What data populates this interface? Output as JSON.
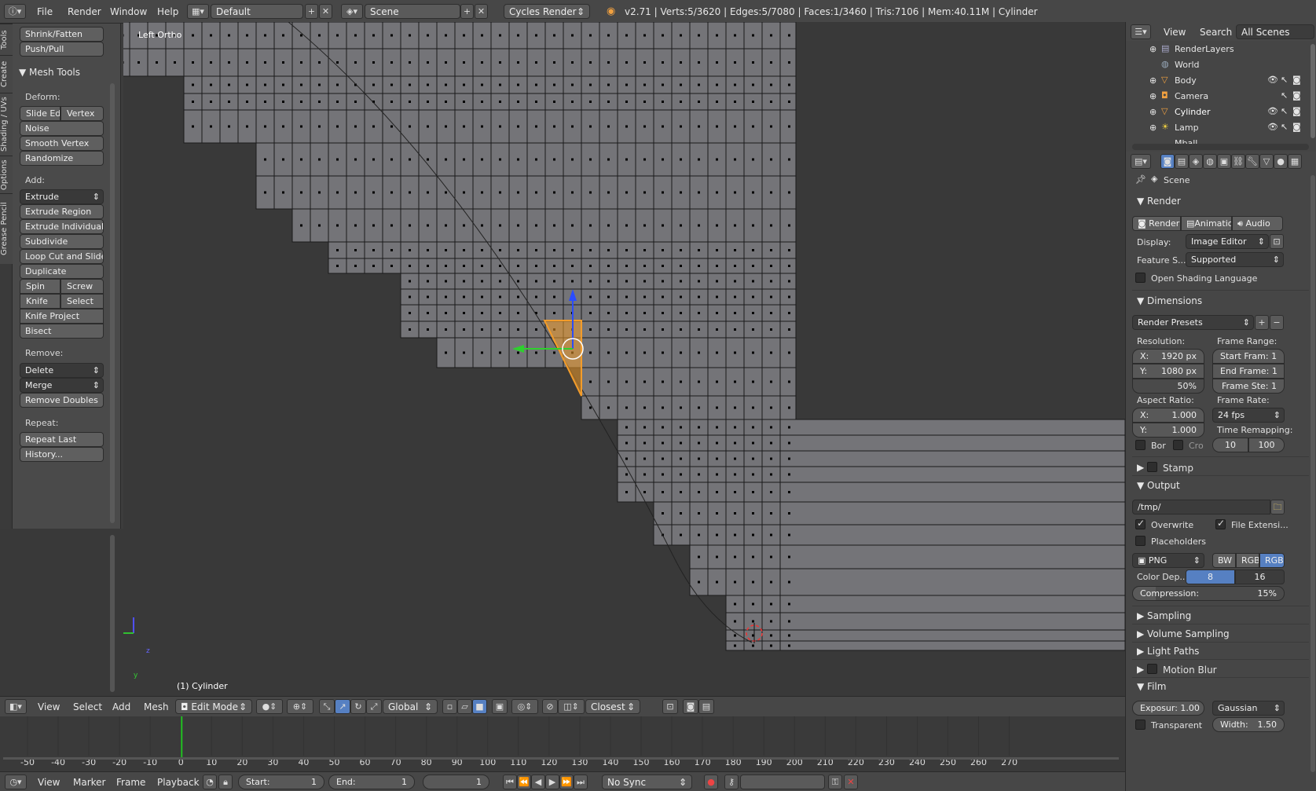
{
  "topbar": {
    "menus": [
      "File",
      "Render",
      "Window",
      "Help"
    ],
    "layout": "Default",
    "scene": "Scene",
    "engine": "Cycles Render",
    "stats": "v2.71 | Verts:5/3620 | Edges:5/7080 | Faces:1/3460 | Tris:7106 | Mem:40.11M | Cylinder"
  },
  "vtabs": [
    "Tools",
    "Create",
    "Shading / UVs",
    "Options",
    "Grease Pencil"
  ],
  "tools": {
    "top_buttons": [
      "Shrink/Fatten",
      "Push/Pull"
    ],
    "section": "Mesh Tools",
    "deform_label": "Deform:",
    "slide_edge": "Slide Ed",
    "vertex": "Vertex",
    "deform_buttons": [
      "Noise",
      "Smooth Vertex",
      "Randomize"
    ],
    "add_label": "Add:",
    "extrude": "Extrude",
    "add_buttons": [
      "Extrude Region",
      "Extrude Individual",
      "Subdivide",
      "Loop Cut and Slide",
      "Duplicate"
    ],
    "spin": "Spin",
    "screw": "Screw",
    "knife": "Knife",
    "select": "Select",
    "knife_project": "Knife Project",
    "bisect": "Bisect",
    "remove_label": "Remove:",
    "delete": "Delete",
    "merge": "Merge",
    "remove_doubles": "Remove Doubles",
    "repeat_label": "Repeat:",
    "repeat_last": "Repeat Last",
    "history": "History..."
  },
  "viewport": {
    "view_name": "Left Ortho",
    "object_label": "(1) Cylinder",
    "axis_x": "y",
    "axis_y": "z"
  },
  "vp_header": {
    "menus": [
      "View",
      "Select",
      "Add",
      "Mesh"
    ],
    "mode": "Edit Mode",
    "orientation": "Global",
    "snap": "Closest"
  },
  "timeline": {
    "ticks": [
      "-50",
      "-40",
      "-30",
      "-20",
      "-10",
      "0",
      "10",
      "20",
      "30",
      "40",
      "50",
      "60",
      "70",
      "80",
      "90",
      "100",
      "110",
      "120",
      "130",
      "140",
      "150",
      "160",
      "170",
      "180",
      "190",
      "200",
      "210",
      "220",
      "230",
      "240",
      "250",
      "260",
      "270"
    ],
    "current_frame_marker": 0,
    "footer_menus": [
      "View",
      "Marker",
      "Frame",
      "Playback"
    ],
    "start_label": "Start:",
    "start_value": "1",
    "end_label": "End:",
    "end_value": "1",
    "current": "1",
    "sync": "No Sync"
  },
  "outliner": {
    "view": "View",
    "search": "Search",
    "filter": "All Scenes",
    "rows": [
      "RenderLayers",
      "World",
      "Body",
      "Camera",
      "Cylinder",
      "Lamp",
      "Mball"
    ]
  },
  "props": {
    "context": "Scene",
    "render_section": "Render",
    "render_btn": "Render",
    "anim_btn": "Animatio",
    "audio_btn": "Audio",
    "display_label": "Display:",
    "display_value": "Image Editor",
    "feature_label": "Feature S...",
    "feature_value": "Supported",
    "osl": "Open Shading Language",
    "dimensions": "Dimensions",
    "render_presets": "Render Presets",
    "resolution": "Resolution:",
    "res_x": "X:",
    "res_x_val": "1920 px",
    "res_y": "Y:",
    "res_y_val": "1080 px",
    "res_pct": "50%",
    "frame_range": "Frame Range:",
    "start_frame": "Start Fram: 1",
    "end_frame": "End Frame: 1",
    "frame_step": "Frame Ste: 1",
    "aspect": "Aspect Ratio:",
    "asp_x": "X:",
    "asp_x_val": "1.000",
    "asp_y": "Y:",
    "asp_y_val": "1.000",
    "frame_rate": "Frame Rate:",
    "fps": "24 fps",
    "border": "Bor",
    "crop": "Cro",
    "time_remap": "Time Remapping:",
    "remap_old": "10",
    "remap_new": "100",
    "stamp": "Stamp",
    "output": "Output",
    "path": "/tmp/",
    "overwrite": "Overwrite",
    "file_ext": "File Extensi...",
    "placeholders": "Placeholders",
    "format": "PNG",
    "bw": "BW",
    "rgb": "RGB",
    "rgba": "RGBA",
    "color_depth": "Color Dep...",
    "depth8": "8",
    "depth16": "16",
    "compression": "Compression:",
    "compression_val": "15%",
    "sampling": "Sampling",
    "volume_sampling": "Volume Sampling",
    "light_paths": "Light Paths",
    "motion_blur": "Motion Blur",
    "film": "Film",
    "exposure": "Exposur: 1.00",
    "filter": "Gaussian",
    "transparent": "Transparent",
    "width": "Width:",
    "width_val": "1.50"
  },
  "colors": {
    "accent_blue": "#5680c2",
    "selection_orange": "#f39c2a",
    "mesh_face": "#747478",
    "mesh_edge": "#1a1a1a"
  }
}
